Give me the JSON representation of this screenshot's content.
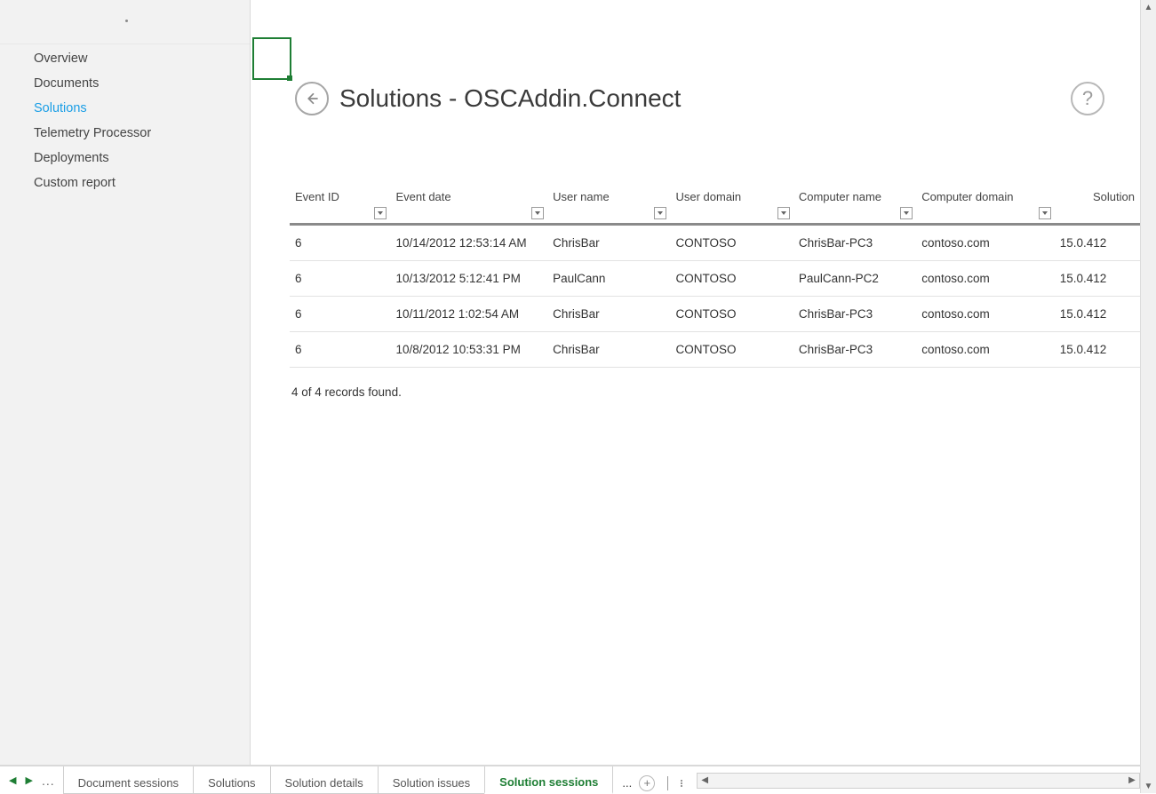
{
  "sidebar": {
    "items": [
      {
        "label": "Overview"
      },
      {
        "label": "Documents"
      },
      {
        "label": "Solutions"
      },
      {
        "label": "Telemetry Processor"
      },
      {
        "label": "Deployments"
      },
      {
        "label": "Custom report"
      }
    ],
    "active_index": 2
  },
  "header": {
    "title": "Solutions - OSCAddin.Connect"
  },
  "table": {
    "columns": [
      {
        "label": "Event ID"
      },
      {
        "label": "Event date"
      },
      {
        "label": "User name"
      },
      {
        "label": "User domain"
      },
      {
        "label": "Computer name"
      },
      {
        "label": "Computer domain"
      },
      {
        "label": "Solution"
      }
    ],
    "rows": [
      {
        "event_id": "6",
        "event_date": "10/14/2012 12:53:14 AM",
        "user_name": "ChrisBar",
        "user_domain": "CONTOSO",
        "computer_name": "ChrisBar-PC3",
        "computer_domain": "contoso.com",
        "solution_version": "15.0.412"
      },
      {
        "event_id": "6",
        "event_date": "10/13/2012 5:12:41 PM",
        "user_name": "PaulCann",
        "user_domain": "CONTOSO",
        "computer_name": "PaulCann-PC2",
        "computer_domain": "contoso.com",
        "solution_version": "15.0.412"
      },
      {
        "event_id": "6",
        "event_date": "10/11/2012 1:02:54 AM",
        "user_name": "ChrisBar",
        "user_domain": "CONTOSO",
        "computer_name": "ChrisBar-PC3",
        "computer_domain": "contoso.com",
        "solution_version": "15.0.412"
      },
      {
        "event_id": "6",
        "event_date": "10/8/2012 10:53:31 PM",
        "user_name": "ChrisBar",
        "user_domain": "CONTOSO",
        "computer_name": "ChrisBar-PC3",
        "computer_domain": "contoso.com",
        "solution_version": "15.0.412"
      }
    ],
    "footer": "4 of 4 records found."
  },
  "tabs": {
    "items": [
      {
        "label": "Document sessions"
      },
      {
        "label": "Solutions"
      },
      {
        "label": "Solution details"
      },
      {
        "label": "Solution issues"
      },
      {
        "label": "Solution sessions"
      }
    ],
    "active_index": 4,
    "more": "...",
    "nav_more": "..."
  },
  "glyphs": {
    "help": "?",
    "plus": "+",
    "tri_left": "◀",
    "tri_right": "▶",
    "tri_up": "▲",
    "tri_down": "▼",
    "arrow_left": "←"
  }
}
